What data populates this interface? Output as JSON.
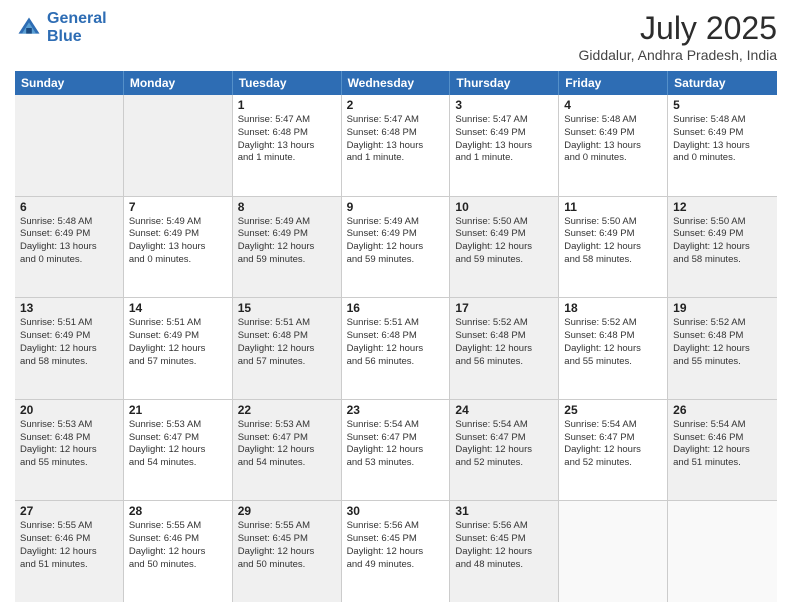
{
  "logo": {
    "line1": "General",
    "line2": "Blue"
  },
  "title": "July 2025",
  "subtitle": "Giddalur, Andhra Pradesh, India",
  "header_days": [
    "Sunday",
    "Monday",
    "Tuesday",
    "Wednesday",
    "Thursday",
    "Friday",
    "Saturday"
  ],
  "weeks": [
    [
      {
        "day": "",
        "info": "",
        "shaded": true
      },
      {
        "day": "",
        "info": "",
        "shaded": true
      },
      {
        "day": "1",
        "info": "Sunrise: 5:47 AM\nSunset: 6:48 PM\nDaylight: 13 hours\nand 1 minute.",
        "shaded": false
      },
      {
        "day": "2",
        "info": "Sunrise: 5:47 AM\nSunset: 6:48 PM\nDaylight: 13 hours\nand 1 minute.",
        "shaded": false
      },
      {
        "day": "3",
        "info": "Sunrise: 5:47 AM\nSunset: 6:49 PM\nDaylight: 13 hours\nand 1 minute.",
        "shaded": false
      },
      {
        "day": "4",
        "info": "Sunrise: 5:48 AM\nSunset: 6:49 PM\nDaylight: 13 hours\nand 0 minutes.",
        "shaded": false
      },
      {
        "day": "5",
        "info": "Sunrise: 5:48 AM\nSunset: 6:49 PM\nDaylight: 13 hours\nand 0 minutes.",
        "shaded": false
      }
    ],
    [
      {
        "day": "6",
        "info": "Sunrise: 5:48 AM\nSunset: 6:49 PM\nDaylight: 13 hours\nand 0 minutes.",
        "shaded": true
      },
      {
        "day": "7",
        "info": "Sunrise: 5:49 AM\nSunset: 6:49 PM\nDaylight: 13 hours\nand 0 minutes.",
        "shaded": false
      },
      {
        "day": "8",
        "info": "Sunrise: 5:49 AM\nSunset: 6:49 PM\nDaylight: 12 hours\nand 59 minutes.",
        "shaded": true
      },
      {
        "day": "9",
        "info": "Sunrise: 5:49 AM\nSunset: 6:49 PM\nDaylight: 12 hours\nand 59 minutes.",
        "shaded": false
      },
      {
        "day": "10",
        "info": "Sunrise: 5:50 AM\nSunset: 6:49 PM\nDaylight: 12 hours\nand 59 minutes.",
        "shaded": true
      },
      {
        "day": "11",
        "info": "Sunrise: 5:50 AM\nSunset: 6:49 PM\nDaylight: 12 hours\nand 58 minutes.",
        "shaded": false
      },
      {
        "day": "12",
        "info": "Sunrise: 5:50 AM\nSunset: 6:49 PM\nDaylight: 12 hours\nand 58 minutes.",
        "shaded": true
      }
    ],
    [
      {
        "day": "13",
        "info": "Sunrise: 5:51 AM\nSunset: 6:49 PM\nDaylight: 12 hours\nand 58 minutes.",
        "shaded": true
      },
      {
        "day": "14",
        "info": "Sunrise: 5:51 AM\nSunset: 6:49 PM\nDaylight: 12 hours\nand 57 minutes.",
        "shaded": false
      },
      {
        "day": "15",
        "info": "Sunrise: 5:51 AM\nSunset: 6:48 PM\nDaylight: 12 hours\nand 57 minutes.",
        "shaded": true
      },
      {
        "day": "16",
        "info": "Sunrise: 5:51 AM\nSunset: 6:48 PM\nDaylight: 12 hours\nand 56 minutes.",
        "shaded": false
      },
      {
        "day": "17",
        "info": "Sunrise: 5:52 AM\nSunset: 6:48 PM\nDaylight: 12 hours\nand 56 minutes.",
        "shaded": true
      },
      {
        "day": "18",
        "info": "Sunrise: 5:52 AM\nSunset: 6:48 PM\nDaylight: 12 hours\nand 55 minutes.",
        "shaded": false
      },
      {
        "day": "19",
        "info": "Sunrise: 5:52 AM\nSunset: 6:48 PM\nDaylight: 12 hours\nand 55 minutes.",
        "shaded": true
      }
    ],
    [
      {
        "day": "20",
        "info": "Sunrise: 5:53 AM\nSunset: 6:48 PM\nDaylight: 12 hours\nand 55 minutes.",
        "shaded": true
      },
      {
        "day": "21",
        "info": "Sunrise: 5:53 AM\nSunset: 6:47 PM\nDaylight: 12 hours\nand 54 minutes.",
        "shaded": false
      },
      {
        "day": "22",
        "info": "Sunrise: 5:53 AM\nSunset: 6:47 PM\nDaylight: 12 hours\nand 54 minutes.",
        "shaded": true
      },
      {
        "day": "23",
        "info": "Sunrise: 5:54 AM\nSunset: 6:47 PM\nDaylight: 12 hours\nand 53 minutes.",
        "shaded": false
      },
      {
        "day": "24",
        "info": "Sunrise: 5:54 AM\nSunset: 6:47 PM\nDaylight: 12 hours\nand 52 minutes.",
        "shaded": true
      },
      {
        "day": "25",
        "info": "Sunrise: 5:54 AM\nSunset: 6:47 PM\nDaylight: 12 hours\nand 52 minutes.",
        "shaded": false
      },
      {
        "day": "26",
        "info": "Sunrise: 5:54 AM\nSunset: 6:46 PM\nDaylight: 12 hours\nand 51 minutes.",
        "shaded": true
      }
    ],
    [
      {
        "day": "27",
        "info": "Sunrise: 5:55 AM\nSunset: 6:46 PM\nDaylight: 12 hours\nand 51 minutes.",
        "shaded": true
      },
      {
        "day": "28",
        "info": "Sunrise: 5:55 AM\nSunset: 6:46 PM\nDaylight: 12 hours\nand 50 minutes.",
        "shaded": false
      },
      {
        "day": "29",
        "info": "Sunrise: 5:55 AM\nSunset: 6:45 PM\nDaylight: 12 hours\nand 50 minutes.",
        "shaded": true
      },
      {
        "day": "30",
        "info": "Sunrise: 5:56 AM\nSunset: 6:45 PM\nDaylight: 12 hours\nand 49 minutes.",
        "shaded": false
      },
      {
        "day": "31",
        "info": "Sunrise: 5:56 AM\nSunset: 6:45 PM\nDaylight: 12 hours\nand 48 minutes.",
        "shaded": true
      },
      {
        "day": "",
        "info": "",
        "shaded": false
      },
      {
        "day": "",
        "info": "",
        "shaded": false
      }
    ]
  ]
}
